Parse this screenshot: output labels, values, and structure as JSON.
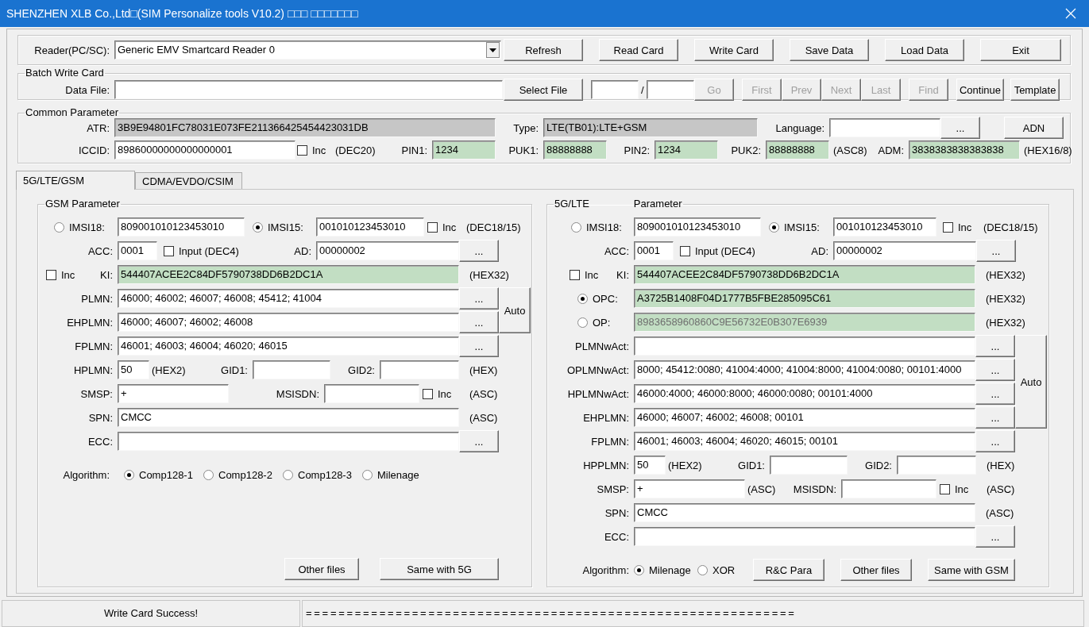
{
  "window": {
    "title": "SHENZHEN XLB Co.,Ltd□(SIM Personalize tools V10.2) □□□ □□□□□□□"
  },
  "reader": {
    "rows": [
      {
        "kind": "line",
        "items": [
          {
            "kind": "label",
            "text": "Reader(PC/SC):"
          },
          {
            "kind": "combo",
            "value": "Generic EMV Smartcard Reader 0"
          },
          {
            "kind": "button",
            "label": "Refresh"
          },
          {
            "kind": "button",
            "label": "Read Card"
          },
          {
            "kind": "button",
            "label": "Write Card"
          },
          {
            "kind": "button",
            "label": "Save Data"
          },
          {
            "kind": "button",
            "label": "Load Data"
          },
          {
            "kind": "button",
            "label": "Exit"
          }
        ]
      }
    ]
  },
  "batch": {
    "title": "Batch Write Card",
    "rows": [
      {
        "kind": "line",
        "items": [
          {
            "kind": "label",
            "text": "Data File:"
          },
          {
            "kind": "field"
          },
          {
            "kind": "button",
            "label": "Select File",
            "disabled": false
          },
          {
            "kind": "field"
          },
          {
            "kind": "note",
            "text": "/"
          },
          {
            "kind": "field"
          },
          {
            "kind": "button",
            "label": "Go",
            "disabled": true
          },
          {
            "kind": "button",
            "label": "First",
            "disabled": true
          },
          {
            "kind": "button",
            "label": "Prev",
            "disabled": true
          },
          {
            "kind": "button",
            "label": "Next",
            "disabled": true
          },
          {
            "kind": "button",
            "label": "Last",
            "disabled": true
          },
          {
            "kind": "button",
            "label": "Find",
            "disabled": true
          },
          {
            "kind": "button",
            "label": "Continue",
            "disabled": false
          },
          {
            "kind": "button",
            "label": "Template",
            "disabled": false
          }
        ]
      }
    ]
  },
  "common": {
    "title": "Common Parameter",
    "rows": [
      {
        "kind": "line",
        "items": [
          {
            "kind": "label",
            "text": "ATR:"
          },
          {
            "kind": "field-grey",
            "value": "3B9E94801FC78031E073FE211366425454423031DB"
          },
          {
            "kind": "label",
            "text": "Type:"
          },
          {
            "kind": "field-grey",
            "value": "LTE(TB01):LTE+GSM"
          },
          {
            "kind": "label",
            "text": "Language:"
          },
          {
            "kind": "field"
          },
          {
            "kind": "button",
            "label": "..."
          },
          {
            "kind": "button",
            "label": "ADN"
          }
        ]
      },
      {
        "kind": "line",
        "items": [
          {
            "kind": "label",
            "text": "ICCID:"
          },
          {
            "kind": "field",
            "value": "89860000000000000001"
          },
          {
            "kind": "check",
            "label": "Inc",
            "checked": false
          },
          {
            "kind": "note",
            "text": "(DEC20)"
          },
          {
            "kind": "label",
            "text": "PIN1:"
          },
          {
            "kind": "field-green",
            "value": "1234"
          },
          {
            "kind": "label",
            "text": "PUK1:"
          },
          {
            "kind": "field-green",
            "value": "88888888"
          },
          {
            "kind": "label",
            "text": "PIN2:"
          },
          {
            "kind": "field-green",
            "value": "1234"
          },
          {
            "kind": "label",
            "text": "PUK2:"
          },
          {
            "kind": "field-green",
            "value": "88888888"
          },
          {
            "kind": "note",
            "text": "(ASC8)"
          },
          {
            "kind": "label",
            "text": "ADM:"
          },
          {
            "kind": "field-green",
            "value": "3838383838383838"
          },
          {
            "kind": "note",
            "text": "(HEX16/8)"
          }
        ]
      }
    ]
  },
  "tabs": [
    {
      "label": "5G/LTE/GSM",
      "selected": true
    },
    {
      "label": "CDMA/EVDO/CSIM",
      "selected": false
    }
  ],
  "gsm": {
    "title": "GSM Parameter",
    "rows": [
      {
        "kind": "line",
        "items": [
          {
            "kind": "radio",
            "label": "IMSI18:",
            "selected": false
          },
          {
            "kind": "field",
            "value": "809001010123453010"
          },
          {
            "kind": "radio",
            "label": "IMSI15:",
            "selected": true
          },
          {
            "kind": "field",
            "value": "001010123453010"
          },
          {
            "kind": "check",
            "label": "Inc",
            "checked": false
          },
          {
            "kind": "note",
            "text": "(DEC18/15)"
          }
        ]
      },
      {
        "kind": "line",
        "items": [
          {
            "kind": "label",
            "text": "ACC:"
          },
          {
            "kind": "field",
            "value": "0001"
          },
          {
            "kind": "check",
            "label": "Input (DEC4)",
            "checked": false
          },
          {
            "kind": "label",
            "text": "AD:"
          },
          {
            "kind": "field",
            "value": "00000002"
          },
          {
            "kind": "button",
            "label": "..."
          }
        ]
      },
      {
        "kind": "line",
        "items": [
          {
            "kind": "check",
            "label": "Inc",
            "checked": false
          },
          {
            "kind": "label",
            "text": "KI:"
          },
          {
            "kind": "field-green",
            "value": "544407ACEE2C84DF5790738DD6B2DC1A"
          },
          {
            "kind": "note",
            "text": "(HEX32)"
          }
        ]
      },
      {
        "kind": "group",
        "rows": [
          {
            "items": [
              {
                "kind": "label",
                "text": "PLMN:"
              },
              {
                "kind": "field",
                "value": "46000; 46002; 46007; 46008; 45412; 41004"
              },
              {
                "kind": "button",
                "label": "..."
              }
            ]
          },
          {
            "items": [
              {
                "kind": "label",
                "text": "EHPLMN:"
              },
              {
                "kind": "field",
                "value": "46000; 46007; 46002; 46008"
              },
              {
                "kind": "button",
                "label": "..."
              }
            ]
          }
        ],
        "side_button": {
          "label": "Auto"
        }
      },
      {
        "kind": "line",
        "items": [
          {
            "kind": "label",
            "text": "FPLMN:"
          },
          {
            "kind": "field",
            "value": "46001; 46003; 46004; 46020; 46015"
          },
          {
            "kind": "button",
            "label": "..."
          }
        ]
      },
      {
        "kind": "line",
        "items": [
          {
            "kind": "label",
            "text": "HPLMN:"
          },
          {
            "kind": "field",
            "value": "50"
          },
          {
            "kind": "note",
            "text": "(HEX2)"
          },
          {
            "kind": "label",
            "text": "GID1:"
          },
          {
            "kind": "field"
          },
          {
            "kind": "label",
            "text": "GID2:"
          },
          {
            "kind": "field"
          },
          {
            "kind": "note",
            "text": "(HEX)"
          }
        ]
      },
      {
        "kind": "line",
        "items": [
          {
            "kind": "label",
            "text": "SMSP:"
          },
          {
            "kind": "field",
            "value": "+"
          },
          {
            "kind": "label",
            "text": "MSISDN:"
          },
          {
            "kind": "field"
          },
          {
            "kind": "check",
            "label": "Inc",
            "checked": false
          },
          {
            "kind": "note",
            "text": "(ASC)"
          }
        ]
      },
      {
        "kind": "line",
        "items": [
          {
            "kind": "label",
            "text": "SPN:"
          },
          {
            "kind": "field",
            "value": "CMCC"
          },
          {
            "kind": "note",
            "text": "(ASC)"
          }
        ]
      },
      {
        "kind": "line",
        "items": [
          {
            "kind": "label",
            "text": "ECC:"
          },
          {
            "kind": "field"
          },
          {
            "kind": "button",
            "label": "..."
          }
        ]
      },
      {
        "kind": "options",
        "items": [
          {
            "kind": "label",
            "text": "Algorithm:"
          },
          {
            "kind": "radio",
            "label": "Comp128-1",
            "selected": true
          },
          {
            "kind": "radio",
            "label": "Comp128-2",
            "selected": false
          },
          {
            "kind": "radio",
            "label": "Comp128-3",
            "selected": false
          },
          {
            "kind": "radio",
            "label": "Milenage",
            "selected": false
          }
        ]
      },
      {
        "kind": "actions",
        "items": [
          {
            "kind": "button",
            "label": "Other files"
          },
          {
            "kind": "button",
            "label": "Same with 5G"
          }
        ]
      }
    ]
  },
  "lte": {
    "title": "5G/LTE",
    "subtitle": "Parameter",
    "rows": [
      {
        "kind": "line",
        "items": [
          {
            "kind": "radio",
            "label": "IMSI18:",
            "selected": false
          },
          {
            "kind": "field",
            "value": "809001010123453010"
          },
          {
            "kind": "radio",
            "label": "IMSI15:",
            "selected": true
          },
          {
            "kind": "field",
            "value": "001010123453010"
          },
          {
            "kind": "check",
            "label": "Inc",
            "checked": false
          },
          {
            "kind": "note",
            "text": "(DEC18/15)"
          }
        ]
      },
      {
        "kind": "line",
        "items": [
          {
            "kind": "label",
            "text": "ACC:"
          },
          {
            "kind": "field",
            "value": "0001"
          },
          {
            "kind": "check",
            "label": "Input (DEC4)",
            "checked": false
          },
          {
            "kind": "label",
            "text": "AD:"
          },
          {
            "kind": "field",
            "value": "00000002"
          },
          {
            "kind": "button",
            "label": "..."
          }
        ]
      },
      {
        "kind": "line",
        "items": [
          {
            "kind": "check",
            "label": "Inc",
            "checked": false
          },
          {
            "kind": "label",
            "text": "KI:"
          },
          {
            "kind": "field-green",
            "value": "544407ACEE2C84DF5790738DD6B2DC1A"
          },
          {
            "kind": "note",
            "text": "(HEX32)"
          }
        ]
      },
      {
        "kind": "line",
        "items": [
          {
            "kind": "radio",
            "label": "OPC:",
            "selected": true
          },
          {
            "kind": "field-green",
            "value": "A3725B1408F04D1777B5FBE285095C61",
            "disabled": false
          },
          {
            "kind": "note",
            "text": "(HEX32)"
          }
        ]
      },
      {
        "kind": "line",
        "items": [
          {
            "kind": "radio",
            "label": "OP:",
            "selected": false
          },
          {
            "kind": "field-green",
            "value": "8983658960860C9E56732E0B307E6939",
            "disabled": true
          },
          {
            "kind": "note",
            "text": "(HEX32)"
          }
        ]
      },
      {
        "kind": "group",
        "rows": [
          {
            "items": [
              {
                "kind": "label",
                "text": "PLMNwAct:"
              },
              {
                "kind": "field"
              },
              {
                "kind": "button",
                "label": "..."
              }
            ]
          },
          {
            "items": [
              {
                "kind": "label",
                "text": "OPLMNwAct:"
              },
              {
                "kind": "field",
                "value": "8000; 45412:0080; 41004:4000; 41004:8000; 41004:0080; 00101:4000"
              },
              {
                "kind": "button",
                "label": "..."
              }
            ]
          },
          {
            "items": [
              {
                "kind": "label",
                "text": "HPLMNwAct:"
              },
              {
                "kind": "field",
                "value": "46000:4000; 46000:8000; 46000:0080; 00101:4000"
              },
              {
                "kind": "button",
                "label": "..."
              }
            ]
          },
          {
            "items": [
              {
                "kind": "label",
                "text": "EHPLMN:"
              },
              {
                "kind": "field",
                "value": "46000; 46007; 46002; 46008; 00101"
              },
              {
                "kind": "button",
                "label": "..."
              }
            ]
          }
        ],
        "side_button": {
          "label": "Auto"
        }
      },
      {
        "kind": "line",
        "items": [
          {
            "kind": "label",
            "text": "FPLMN:"
          },
          {
            "kind": "field",
            "value": "46001; 46003; 46004; 46020; 46015; 00101"
          },
          {
            "kind": "button",
            "label": "..."
          }
        ]
      },
      {
        "kind": "line",
        "items": [
          {
            "kind": "label",
            "text": "HPPLMN:"
          },
          {
            "kind": "field",
            "value": "50"
          },
          {
            "kind": "note",
            "text": "(HEX2)"
          },
          {
            "kind": "label",
            "text": "GID1:"
          },
          {
            "kind": "field"
          },
          {
            "kind": "label",
            "text": "GID2:"
          },
          {
            "kind": "field"
          },
          {
            "kind": "note",
            "text": "(HEX)"
          }
        ]
      },
      {
        "kind": "line",
        "items": [
          {
            "kind": "label",
            "text": "SMSP:"
          },
          {
            "kind": "field",
            "value": "+"
          },
          {
            "kind": "note",
            "text": "(ASC)"
          },
          {
            "kind": "label",
            "text": "MSISDN:"
          },
          {
            "kind": "field"
          },
          {
            "kind": "check",
            "label": "Inc",
            "checked": false
          },
          {
            "kind": "note",
            "text": "(ASC)"
          }
        ]
      },
      {
        "kind": "line",
        "items": [
          {
            "kind": "label",
            "text": "SPN:"
          },
          {
            "kind": "field",
            "value": "CMCC"
          },
          {
            "kind": "note",
            "text": "(ASC)"
          }
        ]
      },
      {
        "kind": "line",
        "items": [
          {
            "kind": "label",
            "text": "ECC:"
          },
          {
            "kind": "field"
          },
          {
            "kind": "button",
            "label": "..."
          }
        ]
      },
      {
        "kind": "options",
        "items": [
          {
            "kind": "label",
            "text": "Algorithm:"
          },
          {
            "kind": "radio",
            "label": "Milenage",
            "selected": true
          },
          {
            "kind": "radio",
            "label": "XOR",
            "selected": false
          },
          {
            "kind": "button",
            "label": "R&C Para"
          },
          {
            "kind": "button",
            "label": "Other files"
          },
          {
            "kind": "button",
            "label": "Same with GSM"
          }
        ]
      }
    ]
  },
  "status_bar": {
    "message": "Write Card Success!",
    "progress_text": "============================================================"
  }
}
